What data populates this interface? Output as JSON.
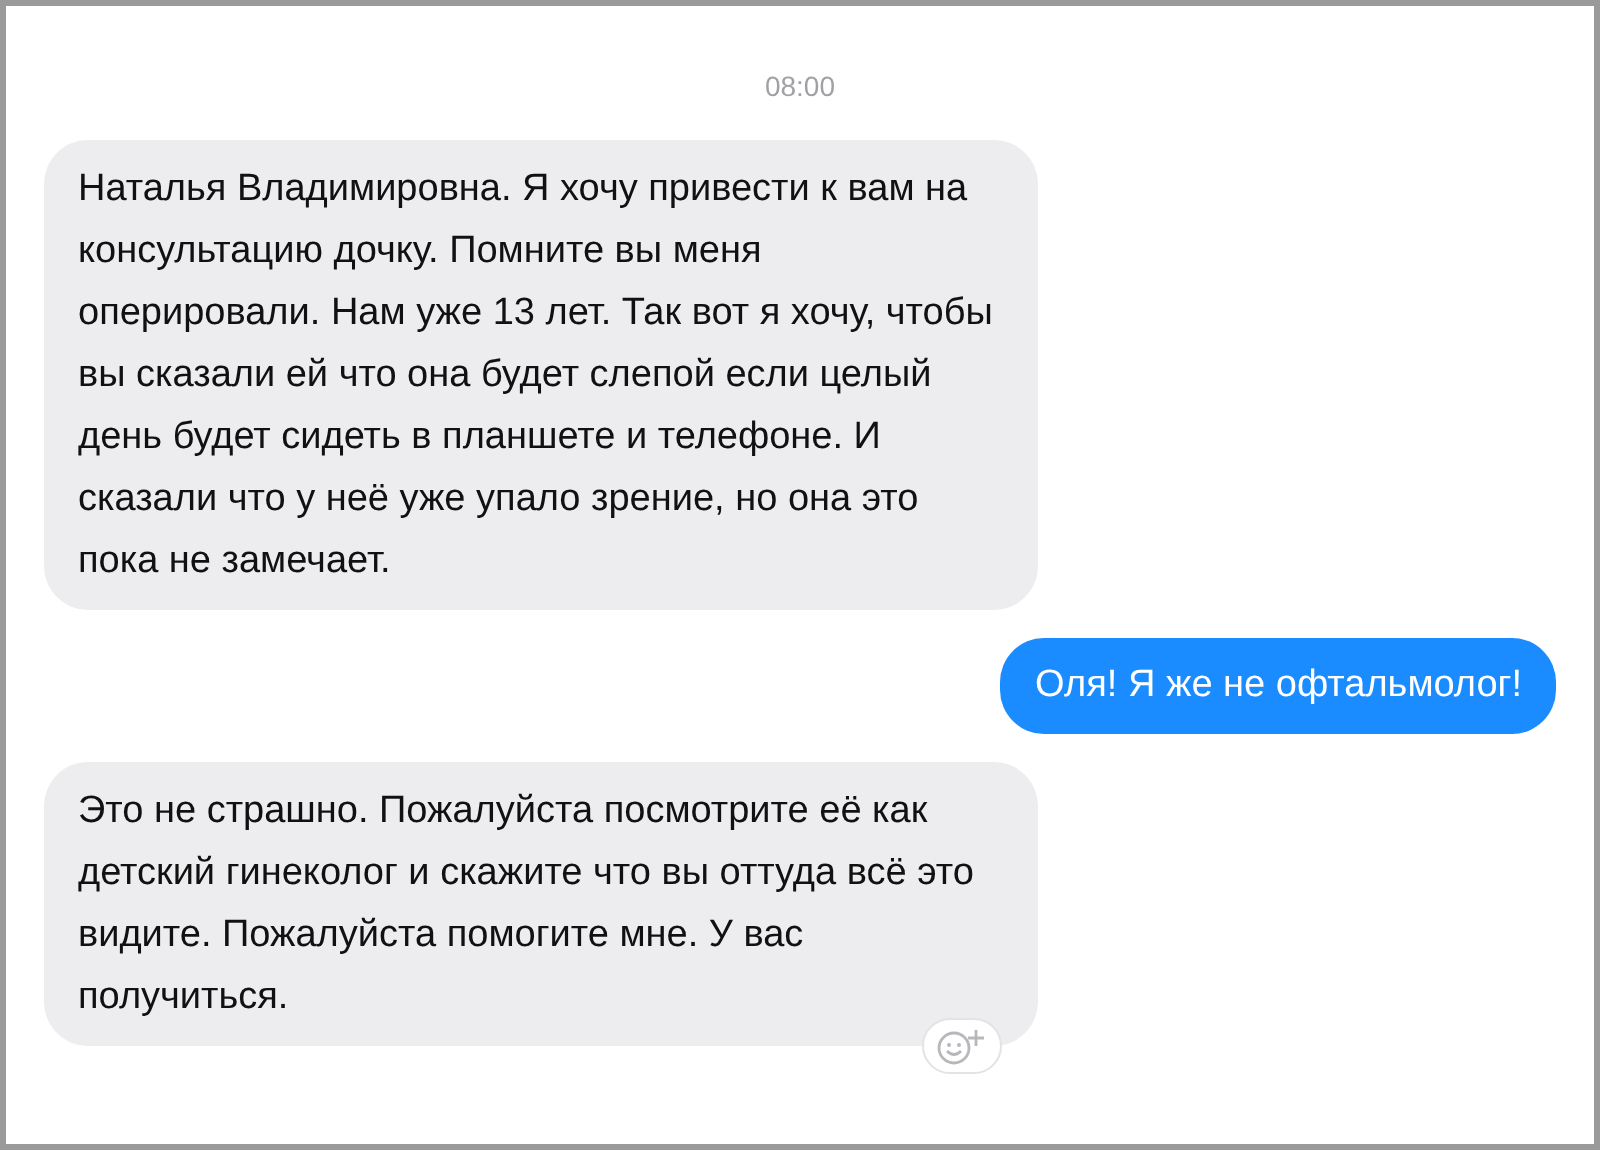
{
  "timestamp": "08:00",
  "messages": [
    {
      "kind": "incoming",
      "text": "Наталья Владимировна. Я хочу привести к вам на консультацию дочку. Помните вы меня оперировали. Нам уже 13 лет. Так вот я хочу, чтобы вы сказали ей что она будет слепой если целый день будет сидеть в планшете и телефоне. И сказали что у неё уже упало зрение, но она это пока не замечает.",
      "reaction_button": false
    },
    {
      "kind": "outgoing",
      "text": "Оля! Я же не офтальмолог!",
      "reaction_button": false
    },
    {
      "kind": "incoming",
      "text": "Это не страшно. Пожалуйста посмотрите её как детский гинеколог и скажите что вы оттуда всё это видите. Пожалуйста помогите мне. У вас получиться.",
      "reaction_button": true
    }
  ]
}
